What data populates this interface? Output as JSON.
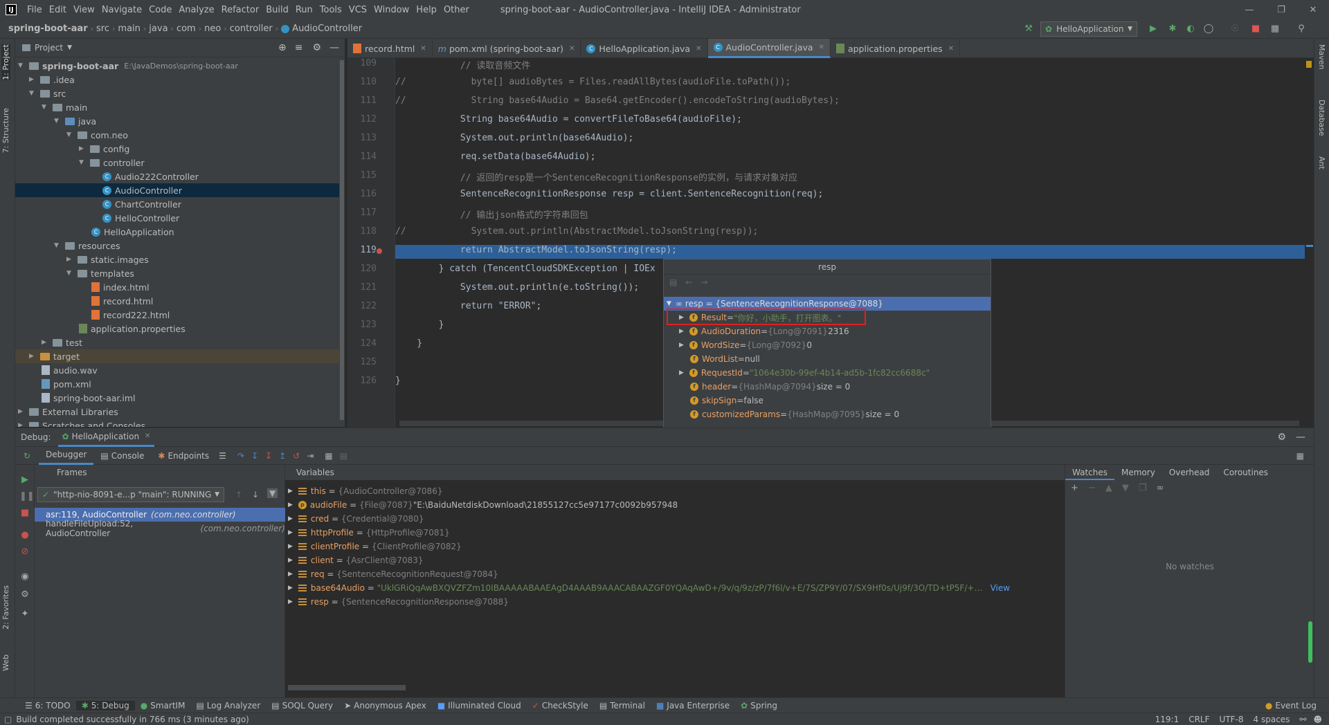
{
  "window": {
    "title": "spring-boot-aar - AudioController.java - IntelliJ IDEA - Administrator",
    "menus": [
      "File",
      "Edit",
      "View",
      "Navigate",
      "Code",
      "Analyze",
      "Refactor",
      "Build",
      "Run",
      "Tools",
      "VCS",
      "Window",
      "Help",
      "Other"
    ]
  },
  "breadcrumb": [
    "spring-boot-aar",
    "src",
    "main",
    "java",
    "com",
    "neo",
    "controller",
    "AudioController"
  ],
  "run_config": "HelloApplication",
  "left_strip": {
    "project": "1: Project",
    "structure": "7: Structure",
    "favorites": "2: Favorites",
    "web": "Web"
  },
  "right_strip": {
    "maven": "Maven",
    "database": "Database",
    "ant": "Ant"
  },
  "project": {
    "header": "Project",
    "tree": [
      {
        "label": "spring-boot-aar",
        "extra": "E:\\JavaDemos\\spring-boot-aar"
      },
      {
        "label": ".idea"
      },
      {
        "label": "src"
      },
      {
        "label": "main"
      },
      {
        "label": "java"
      },
      {
        "label": "com.neo"
      },
      {
        "label": "config"
      },
      {
        "label": "controller"
      },
      {
        "label": "Audio222Controller"
      },
      {
        "label": "AudioController"
      },
      {
        "label": "ChartController"
      },
      {
        "label": "HelloController"
      },
      {
        "label": "HelloApplication"
      },
      {
        "label": "resources"
      },
      {
        "label": "static.images"
      },
      {
        "label": "templates"
      },
      {
        "label": "index.html"
      },
      {
        "label": "record.html"
      },
      {
        "label": "record222.html"
      },
      {
        "label": "application.properties"
      },
      {
        "label": "test"
      },
      {
        "label": "target"
      },
      {
        "label": "audio.wav"
      },
      {
        "label": "pom.xml"
      },
      {
        "label": "spring-boot-aar.iml"
      },
      {
        "label": "External Libraries"
      },
      {
        "label": "Scratches and Consoles"
      }
    ]
  },
  "tabs": [
    "record.html",
    "pom.xml (spring-boot-aar)",
    "HelloApplication.java",
    "AudioController.java",
    "application.properties"
  ],
  "code": {
    "line_numbers": [
      "109",
      "110",
      "111",
      "112",
      "113",
      "114",
      "115",
      "116",
      "117",
      "118",
      "119",
      "120",
      "121",
      "122",
      "123",
      "124",
      "125",
      "126"
    ],
    "lines": [
      "            // 读取音频文件",
      "//            byte[] audioBytes = Files.readAllBytes(audioFile.toPath());",
      "//            String base64Audio = Base64.getEncoder().encodeToString(audioBytes);",
      "            String base64Audio = convertFileToBase64(audioFile);",
      "            System.out.println(base64Audio);",
      "            req.setData(base64Audio);",
      "            // 返回的resp是一个SentenceRecognitionResponse的实例，与请求对象对应",
      "            SentenceRecognitionResponse resp = client.SentenceRecognition(req);",
      "            // 输出json格式的字符串回包",
      "//            System.out.println(AbstractModel.toJsonString(resp));",
      "            return AbstractModel.toJsonString(resp);",
      "        } catch (TencentCloudSDKException | IOEx",
      "            System.out.println(e.toString());",
      "            return \"ERROR\";",
      "        }",
      "    }",
      "",
      "}"
    ]
  },
  "popup": {
    "title": "resp",
    "root": "resp = {SentenceRecognitionResponse@7088}",
    "fields": [
      {
        "name": "Result",
        "eq": " = ",
        "type": "",
        "value": "\"你好，小助手，打开图表。\"",
        "kind": "str"
      },
      {
        "name": "AudioDuration",
        "eq": " = ",
        "type": "{Long@7091}",
        "value": " 2316",
        "kind": "num"
      },
      {
        "name": "WordSize",
        "eq": " = ",
        "type": "{Long@7092}",
        "value": " 0",
        "kind": "num"
      },
      {
        "name": "WordList",
        "eq": " = ",
        "type": "",
        "value": "null",
        "kind": "num"
      },
      {
        "name": "RequestId",
        "eq": " = ",
        "type": "",
        "value": "\"1064e30b-99ef-4b14-ad5b-1fc82cc6688c\"",
        "kind": "str"
      },
      {
        "name": "header",
        "eq": " = ",
        "type": "{HashMap@7094}",
        "value": "  size = 0",
        "kind": "num"
      },
      {
        "name": "skipSign",
        "eq": " = ",
        "type": "",
        "value": "false",
        "kind": "num"
      },
      {
        "name": "customizedParams",
        "eq": " = ",
        "type": "{HashMap@7095}",
        "value": "  size = 0",
        "kind": "num"
      }
    ]
  },
  "debug": {
    "label": "Debug:",
    "session": "HelloApplication",
    "tabs": [
      "Debugger",
      "Console",
      "Endpoints"
    ],
    "frames_header": "Frames",
    "thread": "\"http-nio-8091-e...p \"main\": RUNNING",
    "frames": [
      {
        "method": "asr:119, AudioController",
        "pkg": "(com.neo.controller)"
      },
      {
        "method": "handleFileUpload:52, AudioController",
        "pkg": "(com.neo.controller)"
      }
    ],
    "variables_header": "Variables",
    "variables": [
      {
        "name": "this",
        "type": "{AudioController@7086}",
        "value": ""
      },
      {
        "name": "audioFile",
        "type": "{File@7087}",
        "value": " \"E:\\BaiduNetdiskDownload\\21855127cc5e97177c0092b957948"
      },
      {
        "name": "cred",
        "type": "{Credential@7080}",
        "value": ""
      },
      {
        "name": "httpProfile",
        "type": "{HttpProfile@7081}",
        "value": ""
      },
      {
        "name": "clientProfile",
        "type": "{ClientProfile@7082}",
        "value": ""
      },
      {
        "name": "client",
        "type": "{AsrClient@7083}",
        "value": ""
      },
      {
        "name": "req",
        "type": "{SentenceRecognitionRequest@7084}",
        "value": ""
      },
      {
        "name": "base64Audio",
        "type": "",
        "value": "\"UklGRiQqAwBXQVZFZm10IBAAAAABAAEAgD4AAAB9AAACABAAZGF0YQAqAwD+/9v/q/9z/zP/7f6l/v+E/7S/ZP9Y/07/SX9Hf0s/Uj9f/3O/TD+tP5F/+v/qAB2AU4CMQM..."
      },
      {
        "name": "resp",
        "type": "{SentenceRecognitionResponse@7088}",
        "value": ""
      }
    ],
    "view_link": "View",
    "watch_tabs": [
      "Watches",
      "Memory",
      "Overhead",
      "Coroutines"
    ],
    "no_watches": "No watches"
  },
  "bottom_tabs": [
    "6: TODO",
    "5: Debug",
    "SmartIM",
    "Log Analyzer",
    "SOQL Query",
    "Anonymous Apex",
    "Illuminated Cloud",
    "CheckStyle",
    "Terminal",
    "Java Enterprise",
    "Spring"
  ],
  "event_log": "Event Log",
  "status": {
    "message": "Build completed successfully in 766 ms (3 minutes ago)",
    "position": "119:1",
    "line_sep": "CRLF",
    "encoding": "UTF-8",
    "indent": "4 spaces"
  },
  "colors": {
    "accent": "#4a88c7",
    "highlight_line": "#2d6099",
    "popup_selected": "#4b6eaf",
    "annotation_box": "#e02020"
  }
}
